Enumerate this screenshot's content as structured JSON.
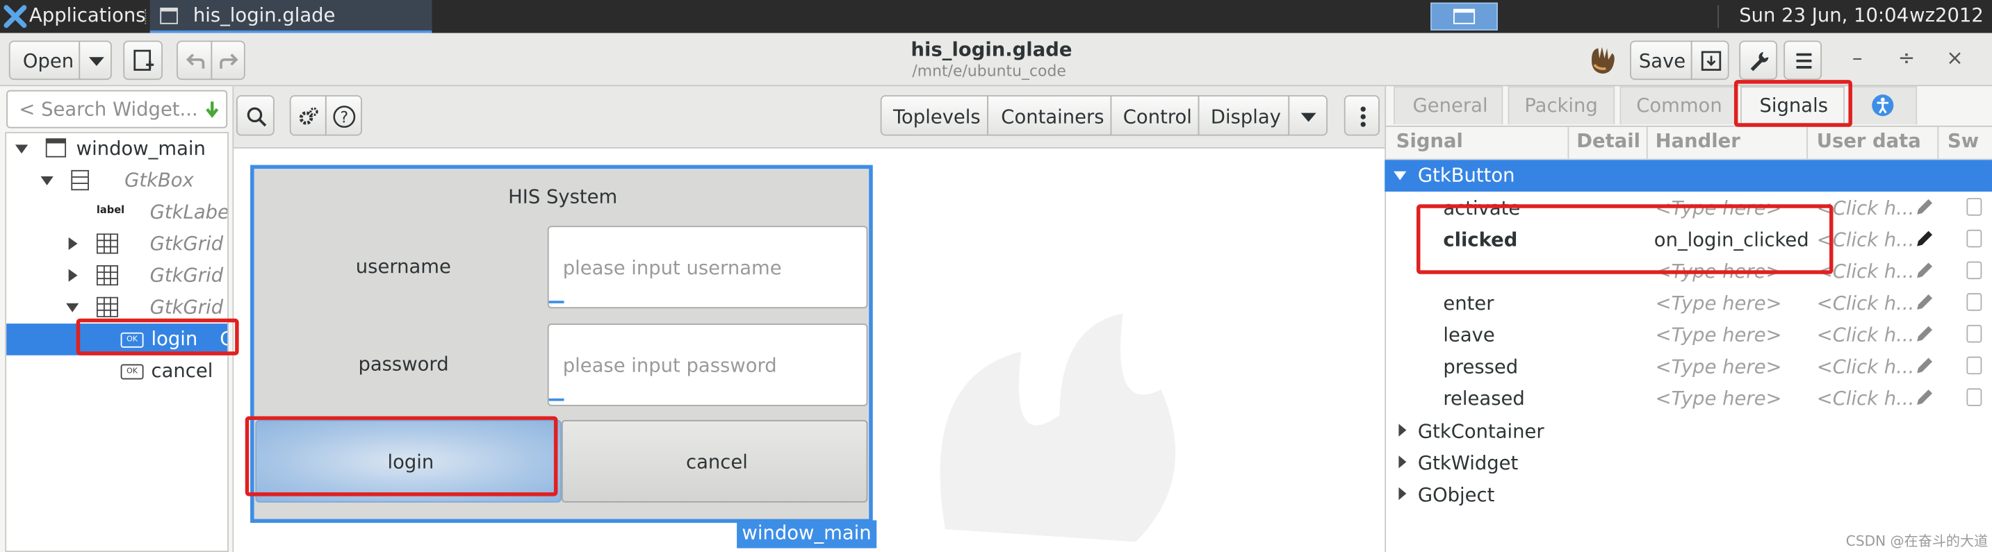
{
  "panel": {
    "apps_label": "Applications",
    "task_title": "his_login.glade",
    "clock": "Sun 23 Jun, 10:04",
    "user": "wz2012"
  },
  "header": {
    "open_label": "Open",
    "title": "his_login.glade",
    "subtitle": "/mnt/e/ubuntu_code",
    "save_label": "Save"
  },
  "left": {
    "search_placeholder": "< Search Widget...",
    "tree": [
      {
        "label": "window_main"
      },
      {
        "label": "GtkBox"
      },
      {
        "label": "GtkLabe"
      },
      {
        "label": "GtkGrid"
      },
      {
        "label": "GtkGrid"
      },
      {
        "label": "GtkGrid"
      },
      {
        "label": "login"
      },
      {
        "label": "cancel"
      }
    ],
    "label_icon_text": "label",
    "ok_icon_text": "OK"
  },
  "toolbar": {
    "palette": [
      "Toplevels",
      "Containers",
      "Control",
      "Display"
    ]
  },
  "dialog": {
    "title": "HIS System",
    "username_label": "username",
    "username_placeholder": "please input username",
    "password_label": "password",
    "password_placeholder": "please input password",
    "login_button": "login",
    "cancel_button": "cancel",
    "window_tag": "window_main"
  },
  "inspector": {
    "tabs": [
      "General",
      "Packing",
      "Common",
      "Signals"
    ],
    "active_tab": "Signals",
    "columns": [
      "Signal",
      "Detail",
      "Handler",
      "User data",
      "Sw"
    ],
    "group_expanded": "GtkButton",
    "signals": [
      {
        "name": "activate",
        "handler": "<Type here>",
        "user_data": "<Click h..."
      },
      {
        "name": "clicked",
        "handler": "on_login_clicked",
        "user_data": "<Click h..."
      },
      {
        "name": "",
        "handler": "<Type here>",
        "user_data": "<Click h..."
      },
      {
        "name": "enter",
        "handler": "<Type here>",
        "user_data": "<Click h..."
      },
      {
        "name": "leave",
        "handler": "<Type here>",
        "user_data": "<Click h..."
      },
      {
        "name": "pressed",
        "handler": "<Type here>",
        "user_data": "<Click h..."
      },
      {
        "name": "released",
        "handler": "<Type here>",
        "user_data": "<Click h..."
      }
    ],
    "groups_collapsed": [
      "GtkContainer",
      "GtkWidget",
      "GObject"
    ]
  },
  "watermark": "CSDN @在奋斗的大道",
  "colors": {
    "selection": "#3584e4",
    "annotation": "#e02020",
    "panel_bg": "#2b2b2b"
  }
}
